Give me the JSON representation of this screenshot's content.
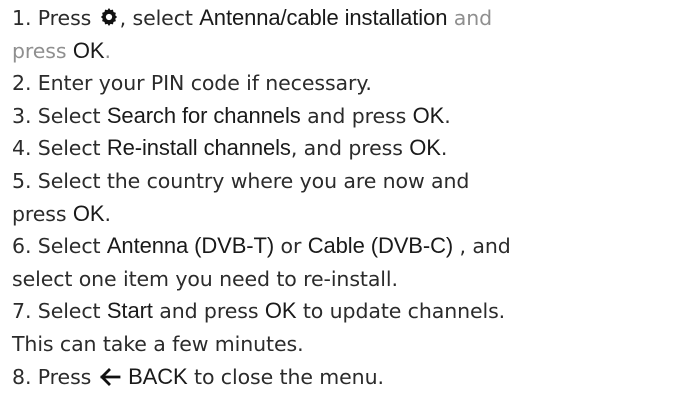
{
  "steps": [
    {
      "n": "1.",
      "a": "Press",
      "icon": "settings-gear-icon",
      "b": ", select",
      "k1": "Antenna/cable installation",
      "c": "and",
      "d": "press",
      "k2": "OK",
      "e": "."
    },
    {
      "n": "2.",
      "a": "Enter your PIN code if necessary."
    },
    {
      "n": "3.",
      "a": "Select",
      "k1": "Search for channels",
      "b": "and press",
      "k2": "OK",
      "c": "."
    },
    {
      "n": "4.",
      "a": "Select",
      "k1": "Re-install channels",
      "b": ", and press",
      "k2": "OK",
      "c": "."
    },
    {
      "n": "5.",
      "a": "Select the country where you are now and",
      "b": "press",
      "k1": "OK",
      "c": "."
    },
    {
      "n": "6.",
      "a": "Select",
      "k1": "Antenna  (DVB-T)",
      "b": "or",
      "k2": "Cable (DVB-C)",
      "c": ", and",
      "d": "select one item you need to re-install."
    },
    {
      "n": "7.",
      "a": "Select",
      "k1": "Start",
      "b": "and press",
      "k2": "OK",
      "c": "to update channels.",
      "d": "This can take a few minutes."
    },
    {
      "n": "8.",
      "a": "Press",
      "icon": "back-arrow-icon",
      "k1": "BACK",
      "b": "to close the menu."
    }
  ]
}
